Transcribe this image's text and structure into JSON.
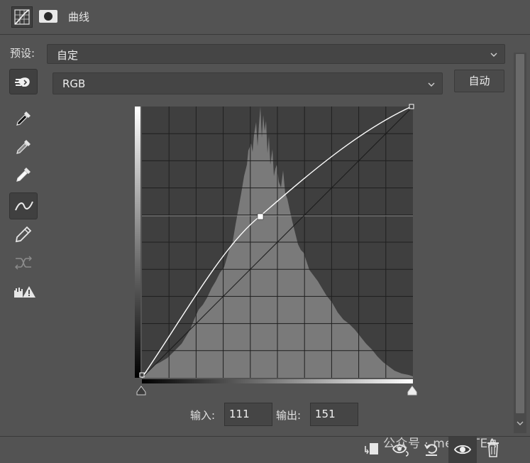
{
  "panel": {
    "title": "曲线"
  },
  "preset": {
    "label": "预设:",
    "value": "自定"
  },
  "channel": {
    "value": "RGB",
    "auto_label": "自动"
  },
  "io": {
    "input_label": "输入:",
    "input_value": "111",
    "output_label": "输出:",
    "output_value": "151"
  },
  "watermark": "公众号 · mediaTEA",
  "icons": {
    "header": [
      "curves-icon",
      "mask-icon"
    ],
    "tools": [
      "on-image-adjust-icon",
      "black-point-eyedropper-icon",
      "gray-point-eyedropper-icon",
      "white-point-eyedropper-icon",
      "curve-points-icon",
      "pencil-icon",
      "smooth-icon",
      "clipping-warning-icon"
    ],
    "footer": [
      "clip-to-layer-icon",
      "view-previous-icon",
      "reset-icon",
      "visibility-icon",
      "delete-icon"
    ]
  },
  "curve": {
    "control_point": {
      "input": 111,
      "output": 151
    },
    "endpoints": [
      {
        "input": 0,
        "output": 0
      },
      {
        "input": 255,
        "output": 255
      }
    ]
  },
  "colors": {
    "panel_bg": "#535353",
    "graph_bg": "#3f3f3f",
    "histogram": "#7a7a7a",
    "curve": "#ffffff"
  }
}
